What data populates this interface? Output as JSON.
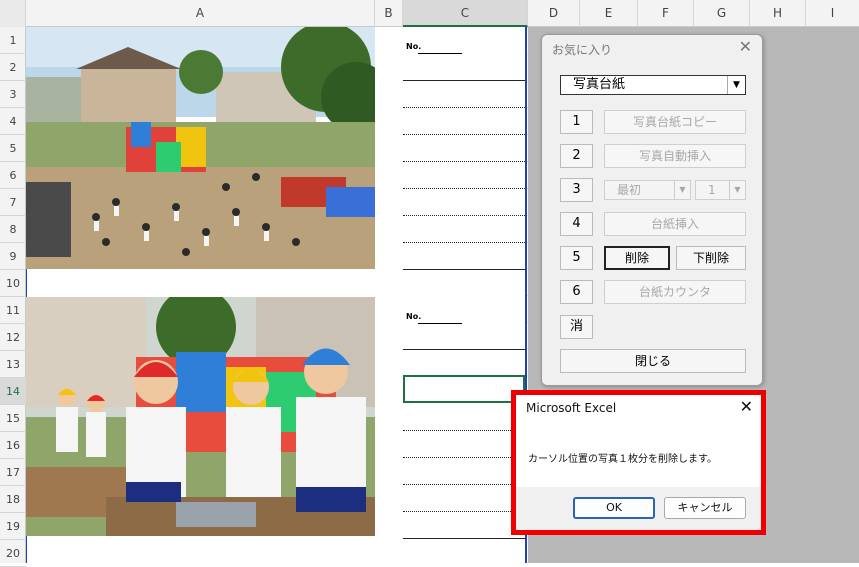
{
  "sheet": {
    "columns": [
      "A",
      "B",
      "C",
      "D",
      "E",
      "F",
      "G",
      "H",
      "I"
    ],
    "rows": [
      "1",
      "2",
      "3",
      "4",
      "5",
      "6",
      "7",
      "8",
      "9",
      "10",
      "11",
      "12",
      "13",
      "14",
      "15",
      "16",
      "17",
      "18",
      "19",
      "20"
    ],
    "no_label_1": "No.",
    "no_label_2": "No."
  },
  "favorites_panel": {
    "title": "お気に入り",
    "close": "✕",
    "dropdown_value": "写真台紙",
    "buttons": [
      {
        "num": "1",
        "label": "写真台紙コピー"
      },
      {
        "num": "2",
        "label": "写真自動挿入"
      },
      {
        "num": "3",
        "first": "最初",
        "count": "1"
      },
      {
        "num": "4",
        "label": "台紙挿入"
      },
      {
        "num": "5",
        "label": "削除",
        "label2": "下削除"
      },
      {
        "num": "6",
        "label": "台紙カウンタ"
      }
    ],
    "erase_button": "消",
    "close_button": "閉じる"
  },
  "message_box": {
    "title": "Microsoft Excel",
    "close": "✕",
    "text": "カーソル位置の写真１枚分を削除します。",
    "ok": "OK",
    "cancel": "キャンセル"
  }
}
